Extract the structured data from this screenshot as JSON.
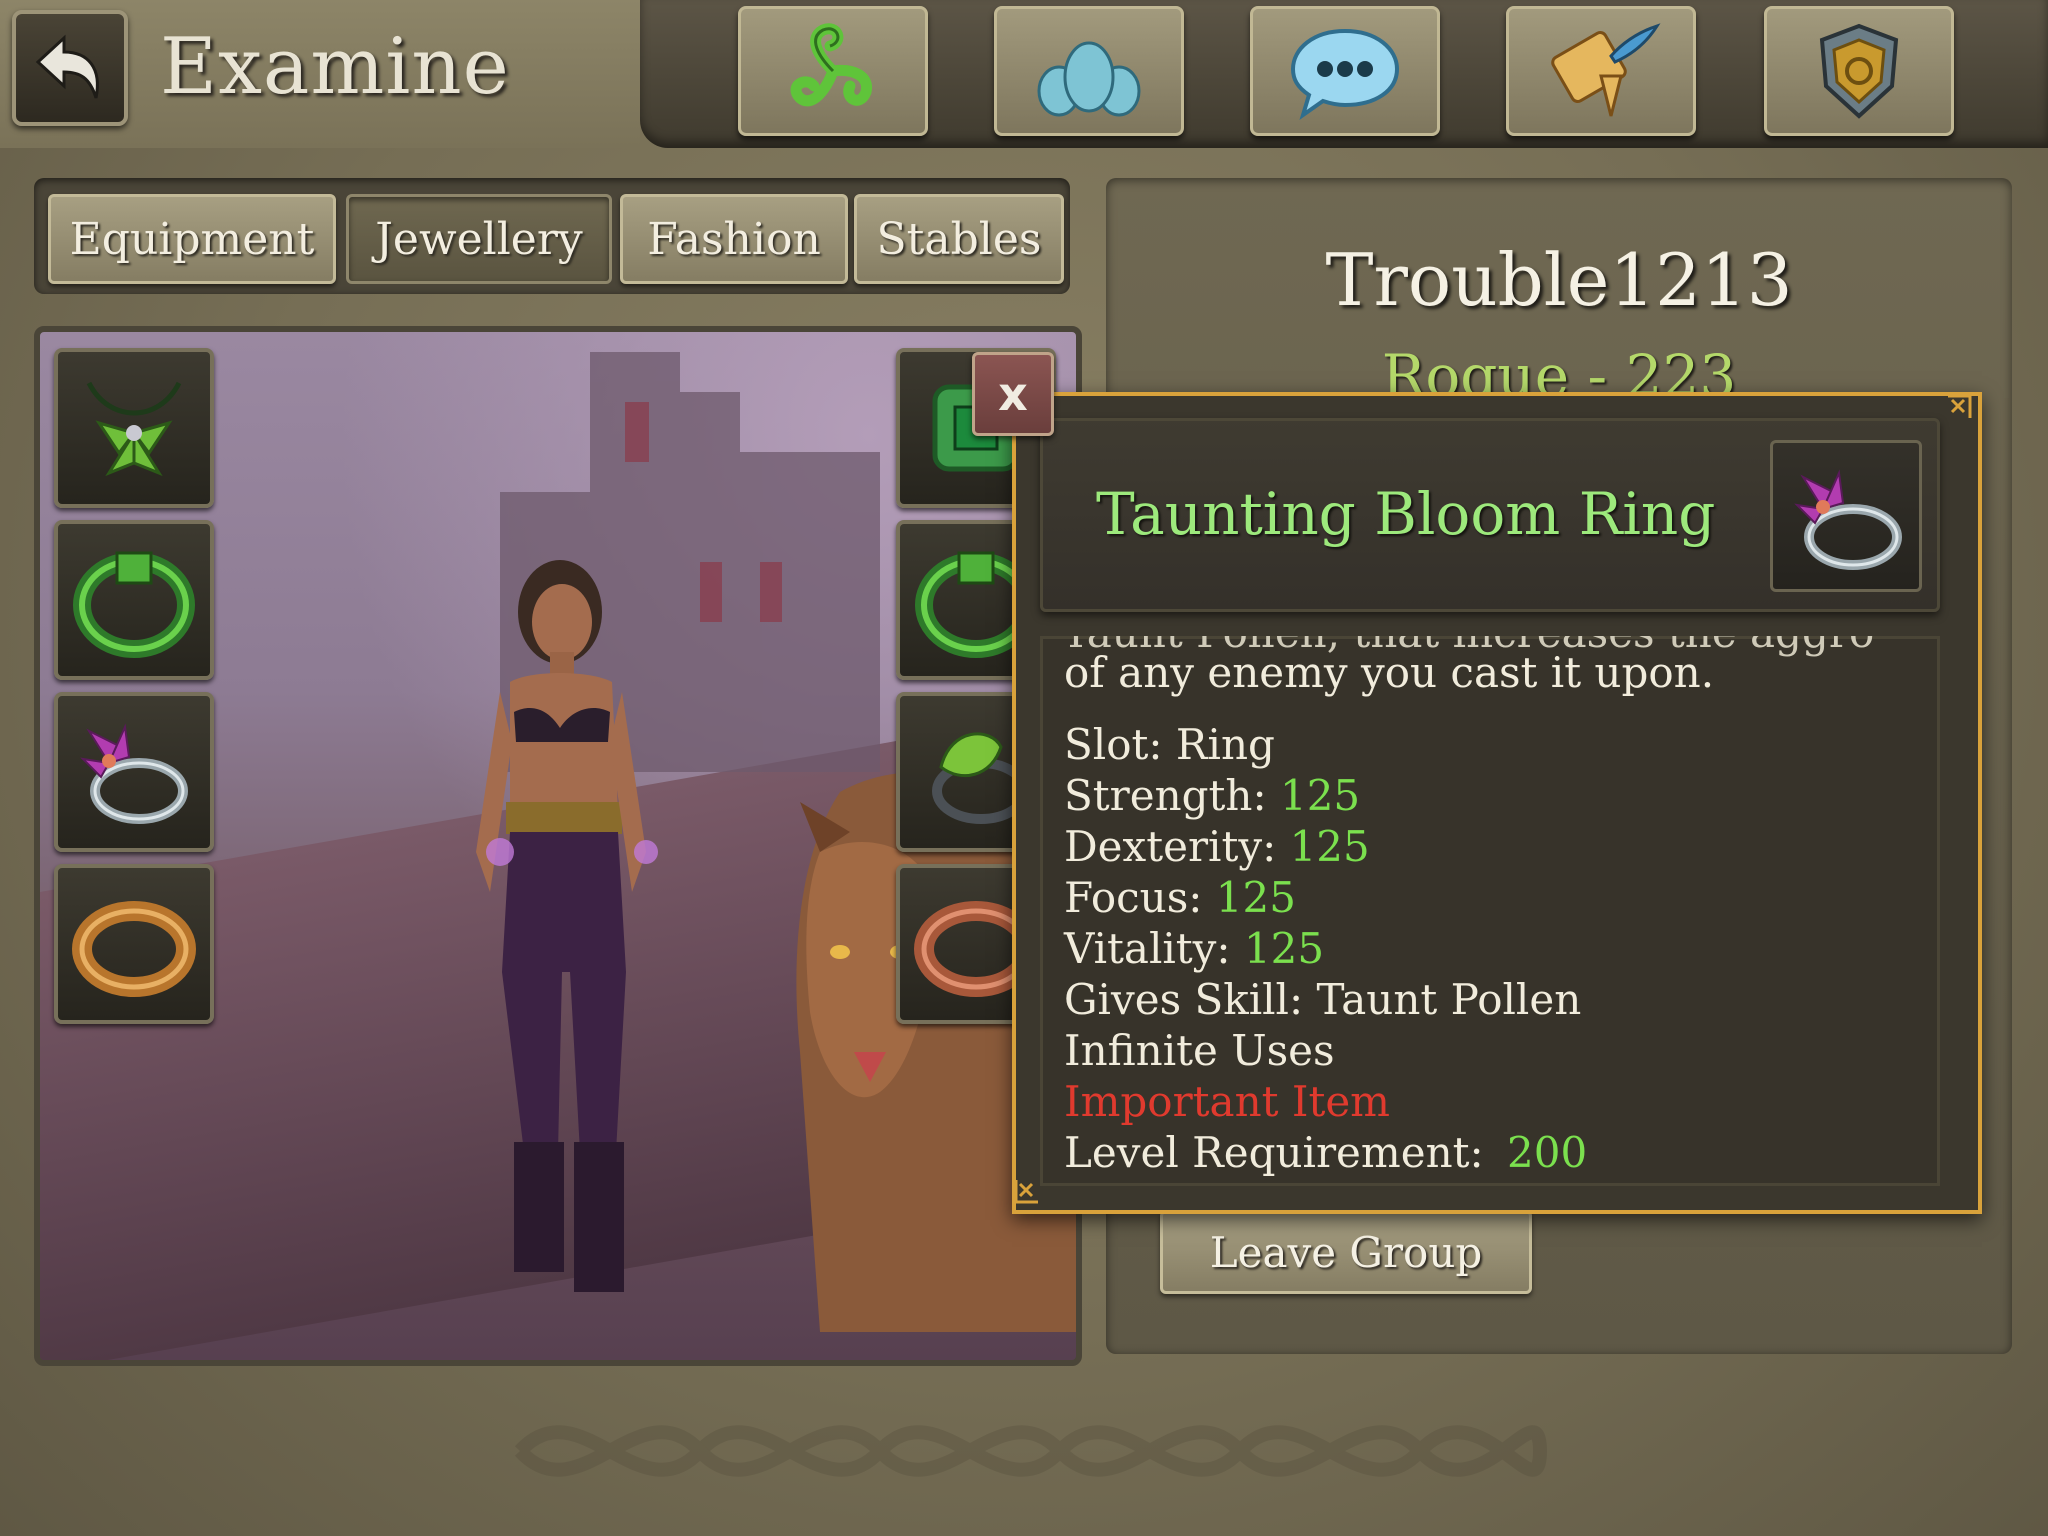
{
  "header": {
    "title": "Examine",
    "nav_icons": [
      "triskele-icon",
      "guild-icon",
      "chat-icon",
      "quest-scroll-icon",
      "shield-icon"
    ]
  },
  "tabs": [
    {
      "label": "Equipment",
      "active": false
    },
    {
      "label": "Jewellery",
      "active": true
    },
    {
      "label": "Fashion",
      "active": false
    },
    {
      "label": "Stables",
      "active": false
    }
  ],
  "slots": {
    "left": [
      "leaf-necklace-icon",
      "green-bracelet-icon",
      "bloom-ring-icon",
      "gold-ring-icon"
    ],
    "right": [
      "emerald-amulet-icon",
      "green-bracelet-icon",
      "leaf-ring-icon",
      "copper-ring-icon"
    ]
  },
  "profile": {
    "name": "Trouble1213",
    "class_level": "Rogue - 223",
    "leave_button": "Leave Group"
  },
  "tooltip": {
    "close_label": "x",
    "item_name": "Taunting Bloom Ring",
    "item_icon": "bloom-ring-icon",
    "description_partial": "Taunt Pollen, that increases the aggro",
    "description": "of any enemy you cast it upon.",
    "stats": [
      {
        "label": "Slot:",
        "value": "Ring",
        "value_color": "white"
      },
      {
        "label": "Strength:",
        "value": "125",
        "value_color": "green"
      },
      {
        "label": "Dexterity:",
        "value": "125",
        "value_color": "green"
      },
      {
        "label": "Focus:",
        "value": "125",
        "value_color": "green"
      },
      {
        "label": "Vitality:",
        "value": "125",
        "value_color": "green"
      },
      {
        "label": "Gives Skill:",
        "value": "Taunt Pollen",
        "value_color": "white"
      },
      {
        "label": "Infinite Uses",
        "value": "",
        "value_color": "white"
      },
      {
        "label": "Important Item",
        "value": "",
        "value_color": "red"
      },
      {
        "label": "Level Requirement:",
        "value": "200",
        "value_color": "green"
      }
    ]
  },
  "colors": {
    "accent_green": "#7be04e",
    "important_red": "#e03a2e",
    "tooltip_border": "#d9a23b",
    "class_text": "#b4d86a"
  }
}
